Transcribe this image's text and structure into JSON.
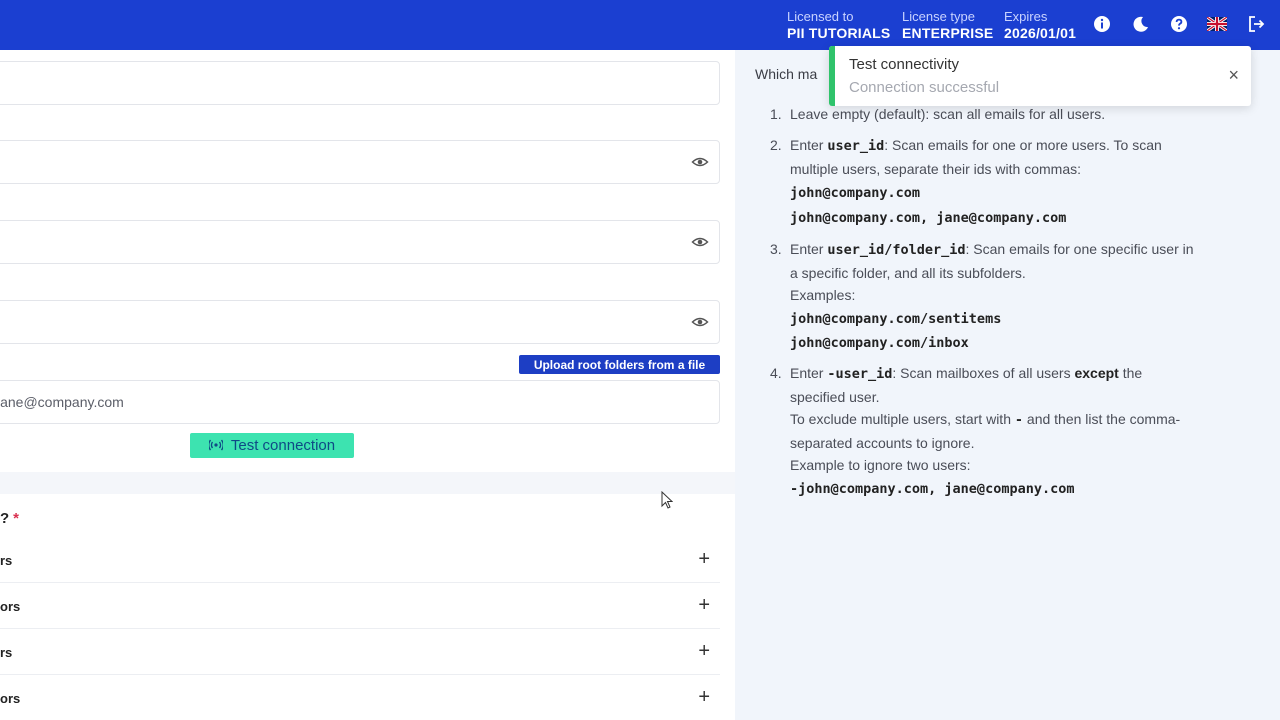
{
  "header": {
    "licensed_to_label": "Licensed to",
    "licensed_to_value": "PII TUTORIALS",
    "license_type_label": "License type",
    "license_type_value": "ENTERPRISE",
    "expires_label": "Expires",
    "expires_value": "2026/01/01",
    "icons": [
      "info-icon",
      "moon-icon",
      "help-icon",
      "uk-flag-icon",
      "logout-icon"
    ]
  },
  "form": {
    "root_folders_value": "jane@company.com",
    "upload_button": "Upload root folders from a file",
    "test_button": "Test connection",
    "question_label": "?",
    "required_mark": "*",
    "accordion_rows": [
      "rs",
      "ors",
      "rs",
      "ors"
    ]
  },
  "help": {
    "which_label": "Which ma",
    "items": [
      {
        "num": "1.",
        "text": "Leave empty (default): scan all emails for all users."
      },
      {
        "num": "2.",
        "pre": "Enter ",
        "code": "user_id",
        "text": ": Scan emails for one or more users. To scan multiple users, separate their ids with commas:",
        "examples": [
          "john@company.com",
          "john@company.com, jane@company.com"
        ]
      },
      {
        "num": "3.",
        "pre": "Enter ",
        "code": "user_id/folder_id",
        "text": ": Scan emails for one specific user in a specific folder, and all its subfolders.",
        "examples_label": "Examples:",
        "examples": [
          "john@company.com/sentitems",
          "john@company.com/inbox"
        ]
      },
      {
        "num": "4.",
        "pre": "Enter ",
        "code": "-user_id",
        "text": ": Scan mailboxes of all users ",
        "bold": "except",
        "text2": " the specified user.",
        "line2_pre": "To exclude multiple users, start with ",
        "line2_code": "-",
        "line2_post": " and then list the comma-separated accounts to ignore.",
        "line3": "Example to ignore two users:",
        "example": "-john@company.com, jane@company.com"
      }
    ]
  },
  "toast": {
    "title": "Test connectivity",
    "message": "Connection successful"
  },
  "colors": {
    "header_bg": "#1b3fd1",
    "upload_btn": "#1d3ec4",
    "test_btn": "#3de3b0",
    "toast_success": "#2fc36b",
    "help_bg": "#f1f5fb"
  }
}
